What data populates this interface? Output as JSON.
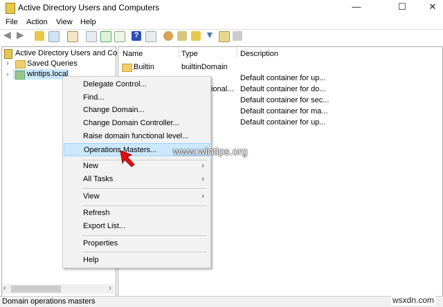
{
  "window": {
    "title": "Active Directory Users and Computers",
    "minimize": "—",
    "maximize": "☐",
    "close": "✕"
  },
  "menubar": [
    "File",
    "Action",
    "View",
    "Help"
  ],
  "tree": {
    "root": "Active Directory Users and Com",
    "items": [
      "Saved Queries",
      "wintips.local"
    ]
  },
  "list": {
    "columns": [
      "Name",
      "Type",
      "Description"
    ],
    "rows": [
      {
        "name": "Builtin",
        "type": "builtinDomain",
        "desc": ""
      },
      {
        "name": "",
        "type": "",
        "desc": "Default container for up..."
      },
      {
        "name": "",
        "type": "ional...",
        "desc": "Default container for do..."
      },
      {
        "name": "",
        "type": "",
        "desc": "Default container for sec..."
      },
      {
        "name": "",
        "type": "",
        "desc": "Default container for ma..."
      },
      {
        "name": "",
        "type": "",
        "desc": "Default container for up..."
      }
    ]
  },
  "context_menu": [
    {
      "label": "Delegate Control..."
    },
    {
      "label": "Find..."
    },
    {
      "label": "Change Domain..."
    },
    {
      "label": "Change Domain Controller..."
    },
    {
      "label": "Raise domain functional level..."
    },
    {
      "label": "Operations Masters...",
      "selected": true
    },
    {
      "label": "New",
      "submenu": true
    },
    {
      "label": "All Tasks",
      "submenu": true
    },
    {
      "label": "View",
      "submenu": true
    },
    {
      "label": "Refresh"
    },
    {
      "label": "Export List..."
    },
    {
      "label": "Properties"
    },
    {
      "label": "Help"
    }
  ],
  "watermark": "www.wintips.org",
  "watermark2": "wsxdn.com",
  "status": "Domain operations masters",
  "arrow": "›"
}
